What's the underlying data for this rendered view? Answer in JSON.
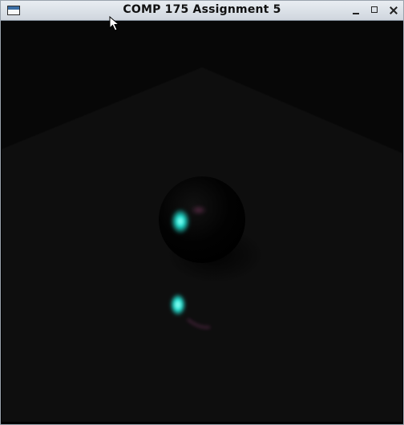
{
  "window": {
    "title": "COMP 175 Assignment 5",
    "buttons": {
      "minimize_icon": "minimize-icon",
      "maximize_icon": "maximize-icon",
      "close_icon": "close-icon"
    }
  },
  "scene": {
    "background": "#000000",
    "floor_color": "#0e0e0e",
    "back_wall_color": "#070707",
    "sphere_color": "#000000",
    "highlight_color": "#20f0e0",
    "secondary_highlight_color": "#8a3a6a",
    "shadow_color": "#050505"
  }
}
